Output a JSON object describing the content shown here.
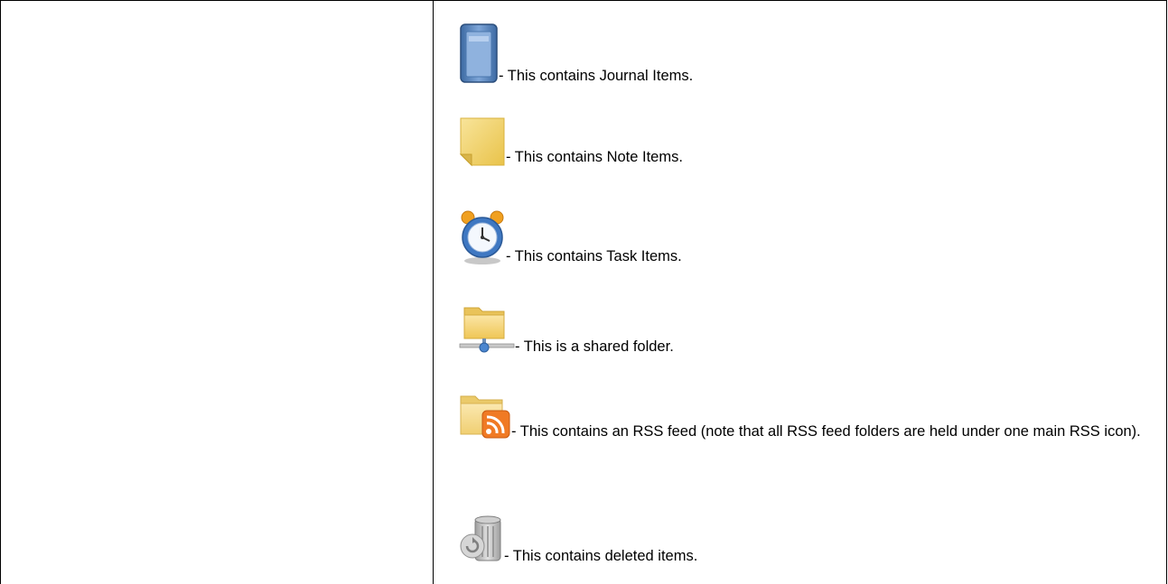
{
  "legend": {
    "items": [
      {
        "icon": "journal-icon",
        "text": "- This contains Journal Items."
      },
      {
        "icon": "note-icon",
        "text": "- This contains Note Items."
      },
      {
        "icon": "task-clock-icon",
        "text": "- This contains Task Items."
      },
      {
        "icon": "shared-folder-icon",
        "text": "- This is a shared folder."
      },
      {
        "icon": "rss-folder-icon",
        "text": "- This contains an RSS feed (note that all RSS feed folders are held under one main RSS icon)."
      },
      {
        "icon": "deleted-items-icon",
        "text": "- This contains deleted items."
      }
    ]
  },
  "colors": {
    "journal_blue": "#4f7fb8",
    "note_yellow": "#f2d45c",
    "clock_orange": "#f0a020",
    "folder_yellow": "#f4d77a",
    "rss_orange": "#f07a24",
    "trash_gray": "#a9a9a9"
  }
}
